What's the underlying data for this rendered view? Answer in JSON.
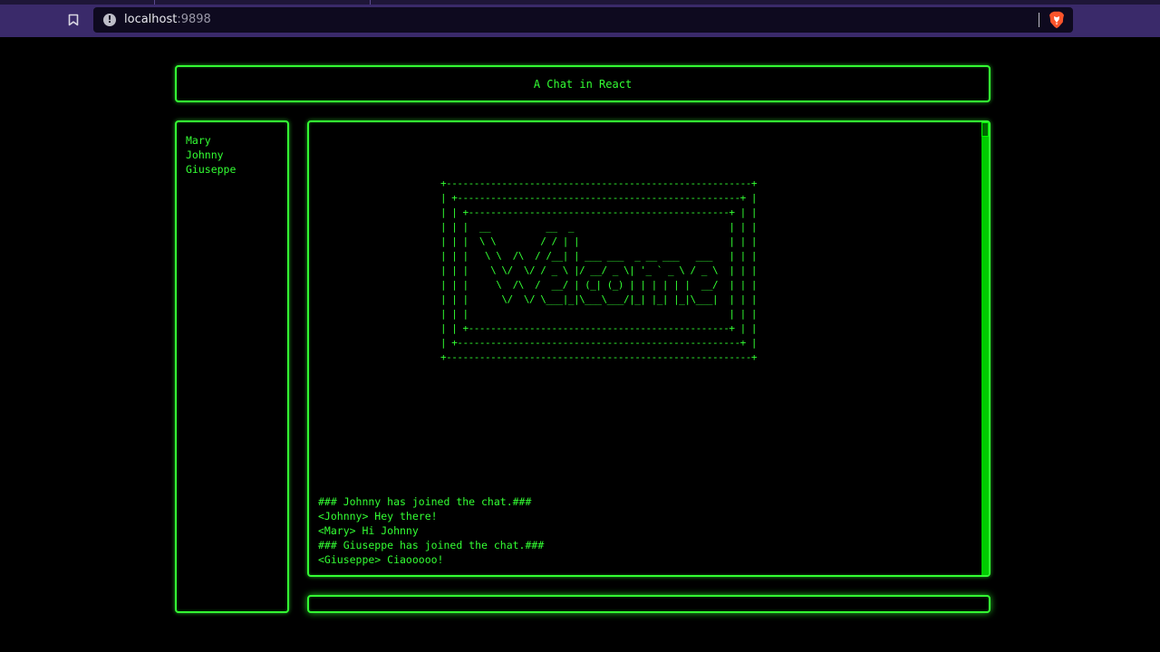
{
  "browser": {
    "url_host": "localhost",
    "url_port": ":9898",
    "info_icon": "!"
  },
  "header": {
    "title": "A Chat in React"
  },
  "users": [
    {
      "name": "Mary"
    },
    {
      "name": "Johnny"
    },
    {
      "name": "Giuseppe"
    }
  ],
  "banner": {
    "art": "+-------------------------------------------------------+\n| +---------------------------------------------------+ |\n| | +-----------------------------------------------+ | |\n| | |  __          __  _                            | | |\n| | |  \\ \\        / / | |                           | | |\n| | |   \\ \\  /\\  / /__| | ___ ___  _ __ ___   ___   | | |\n| | |    \\ \\/  \\/ / _ \\ |/ __/ _ \\| '_ ` _ \\ / _ \\  | | |\n| | |     \\  /\\  /  __/ | (_| (_) | | | | | |  __/  | | |\n| | |      \\/  \\/ \\___|_|\\___\\___/|_| |_| |_|\\___|  | | |\n| | |                                               | | |\n| | +-----------------------------------------------+ | |\n| +---------------------------------------------------+ |\n+-------------------------------------------------------+"
  },
  "messages": [
    {
      "text": "### Johnny has joined the chat.###"
    },
    {
      "text": "<Johnny> Hey there!"
    },
    {
      "text": "<Mary> Hi Johnny"
    },
    {
      "text": "### Giuseppe has joined the chat.###"
    },
    {
      "text": "<Giuseppe> Ciaooooo!"
    }
  ],
  "input": {
    "value": "",
    "placeholder": ""
  },
  "colors": {
    "terminal_green": "#33ff33",
    "background": "#000000",
    "browser_bar": "#3a2a6a",
    "url_bar": "#0e0a1f",
    "brave_orange": "#fb542b"
  },
  "icons": {
    "bookmark": "bookmark-icon",
    "info": "info-icon",
    "brave": "brave-lion-icon"
  }
}
